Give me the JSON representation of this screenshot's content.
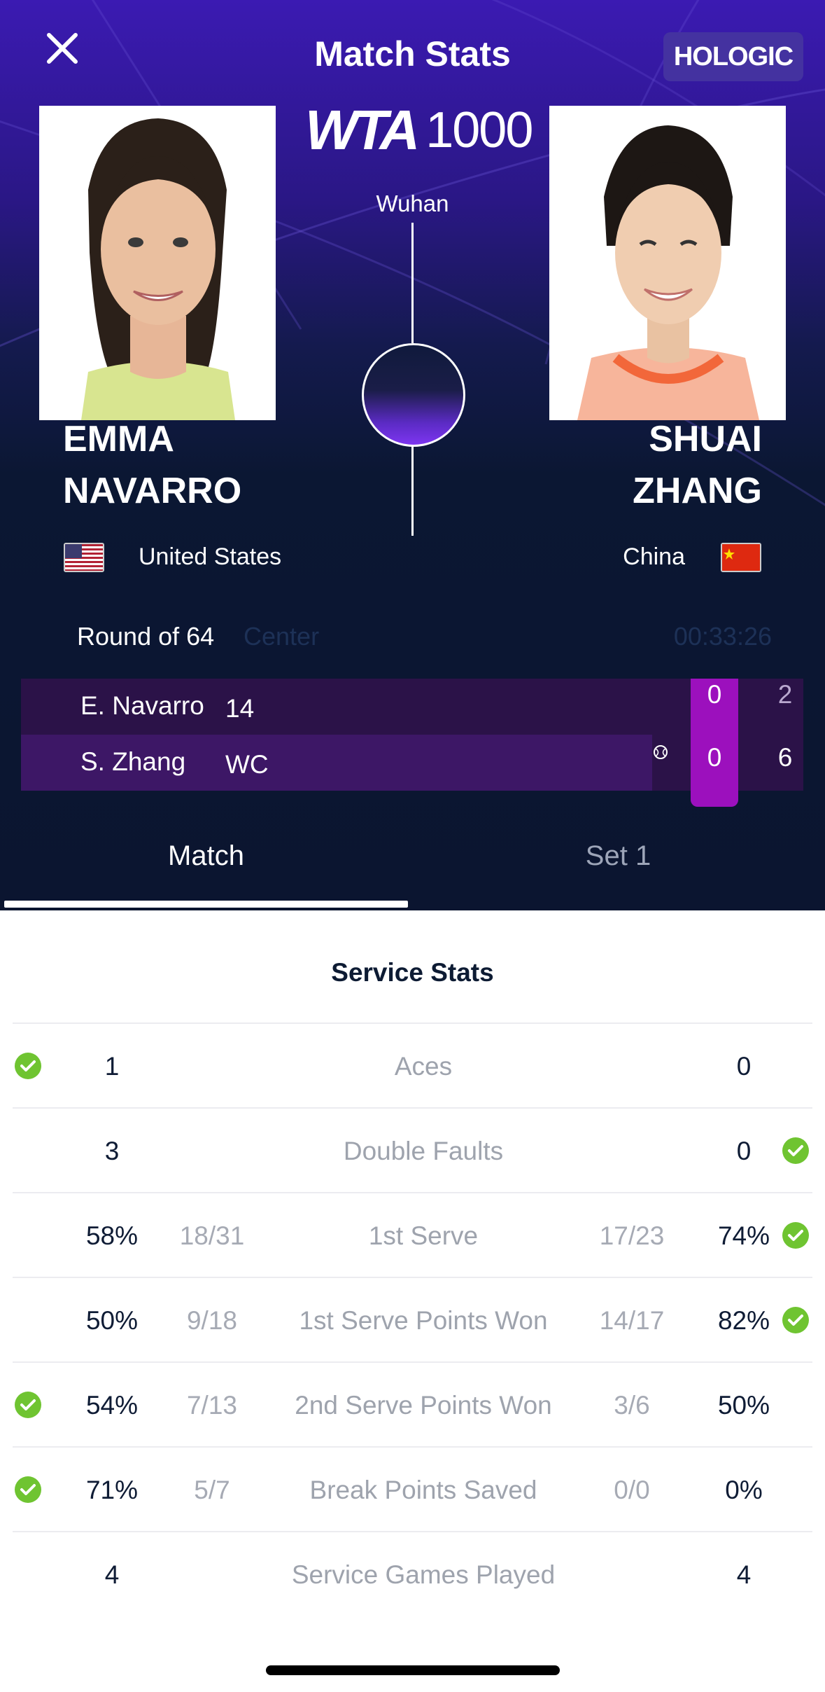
{
  "header": {
    "title": "Match Stats",
    "sponsor": "HOLOGIC"
  },
  "tournament": {
    "logo_mark": "WTA",
    "logo_level": "1000",
    "city": "Wuhan"
  },
  "players": {
    "left": {
      "first": "EMMA",
      "last": "NAVARRO",
      "country": "United States"
    },
    "right": {
      "first": "SHUAI",
      "last": "ZHANG",
      "country": "China"
    }
  },
  "match": {
    "round": "Round of 64",
    "court": "Center",
    "duration": "00:33:26"
  },
  "scoreboard": {
    "rows": [
      {
        "name": "E. Navarro",
        "seed": "14",
        "game": "0",
        "set1": "2"
      },
      {
        "name": "S. Zhang",
        "seed": "WC",
        "game": "0",
        "set1": "6"
      }
    ],
    "serving": "S. Zhang"
  },
  "tabs": [
    {
      "label": "Match",
      "active": true
    },
    {
      "label": "Set 1",
      "active": false
    }
  ],
  "service_stats": {
    "title": "Service Stats",
    "rows": [
      {
        "label": "Aces",
        "left": "1",
        "left_frac": "",
        "right": "0",
        "right_frac": "",
        "winner": "left"
      },
      {
        "label": "Double Faults",
        "left": "3",
        "left_frac": "",
        "right": "0",
        "right_frac": "",
        "winner": "right"
      },
      {
        "label": "1st Serve",
        "left": "58%",
        "left_frac": "18/31",
        "right": "74%",
        "right_frac": "17/23",
        "winner": "right"
      },
      {
        "label": "1st Serve Points Won",
        "left": "50%",
        "left_frac": "9/18",
        "right": "82%",
        "right_frac": "14/17",
        "winner": "right"
      },
      {
        "label": "2nd Serve Points Won",
        "left": "54%",
        "left_frac": "7/13",
        "right": "50%",
        "right_frac": "3/6",
        "winner": "left"
      },
      {
        "label": "Break Points Saved",
        "left": "71%",
        "left_frac": "5/7",
        "right": "0%",
        "right_frac": "0/0",
        "winner": "left"
      },
      {
        "label": "Service Games Played",
        "left": "4",
        "left_frac": "",
        "right": "4",
        "right_frac": "",
        "winner": "none"
      }
    ]
  },
  "colors": {
    "accent": "#9c10bd",
    "winner_check": "#6fc431",
    "hero_top": "#3b1ab2",
    "hero_bottom": "#0b1530"
  },
  "icons": {
    "close": "close-icon",
    "check": "check-circle-icon",
    "serve": "tennis-ball-icon",
    "flag_left": "flag-us-icon",
    "flag_right": "flag-china-icon"
  }
}
